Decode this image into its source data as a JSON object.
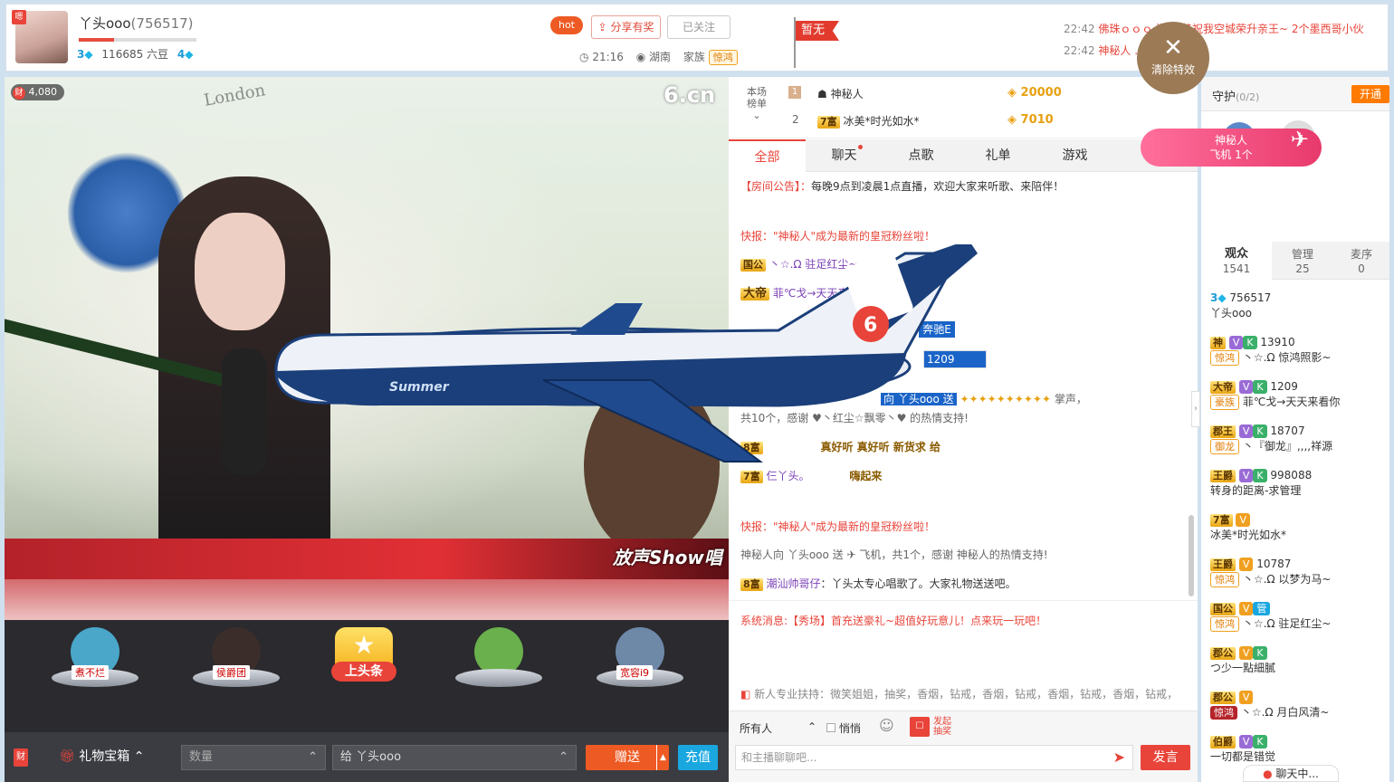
{
  "anchor": {
    "name": "丫头ooo",
    "id": "(756517)",
    "level_left": "3",
    "beans": "116685 六豆",
    "level_right": "4",
    "time": "21:16",
    "location": "湖南",
    "family_label": "家族",
    "family_badge": "惊鸿"
  },
  "header_buttons": {
    "hot": "hot",
    "share": "分享有奖",
    "followed": "已关注"
  },
  "flag": {
    "label": "暂无"
  },
  "ticker": [
    {
      "time": "22:42",
      "text": "佛珠ｏｏｏ 送给 恭祝我空城荣升亲王~ 2个墨西哥小伙"
    },
    {
      "time": "22:42",
      "text": "神秘人 ... 儿 1个别墅"
    }
  ],
  "clear_effects": "清除特效",
  "stage": {
    "wealth_badge": "财",
    "wealth_count": "4,080",
    "logo": "6.cn",
    "corner_logo": "放声Show唱"
  },
  "gifts": [
    {
      "label": "煮不烂",
      "theme": "#4aa7c9"
    },
    {
      "label": "侯爵团",
      "theme": "#3b2e2a"
    },
    {
      "label": "上头条",
      "theme": "#f2c230"
    },
    {
      "label": "",
      "theme": "#6ab04c"
    },
    {
      "label": "宽容i9",
      "theme": "#6e88a8"
    }
  ],
  "bottom": {
    "wealth_icon": "财",
    "treasure": "礼物宝箱",
    "qty_placeholder": "数量",
    "to_prefix": "给",
    "to_name": "丫头ooo",
    "send": "赠送",
    "recharge": "充值"
  },
  "rank": {
    "title_line1": "本场",
    "title_line2": "榜单",
    "rows": [
      {
        "rank": "1",
        "name": "神秘人",
        "amount": "20000"
      },
      {
        "rank": "2",
        "badge": "7富",
        "name": "冰美*时光如水*",
        "amount": "7010"
      }
    ]
  },
  "chat_tabs": [
    "全部",
    "聊天",
    "点歌",
    "礼单",
    "游戏"
  ],
  "chat": {
    "announce_label": "【房间公告】：",
    "announce_text": "每晚9点到凌晨1点直播，欢迎大家来听歌、来陪伴！",
    "flash1": "快报：\"神秘人\"成为最新的皇冠粉丝啦！",
    "l1_badge": "国公",
    "l1_name": "丶☆.Ω 驻足红尘~",
    "l2_badge": "大帝",
    "l2_name": "菲℃戈→天天来看你",
    "l3_tail": "奔驰E",
    "l4_num": "1209",
    "l5_mid": "向 丫头ooo 送",
    "l5_tail": "掌声，",
    "l6": "共10个，感谢 ♥丶红尘☆飘零丶♥ 的热情支持!",
    "l7_badge": "8富",
    "l7_words": "真好听 真好听 新货求 给",
    "l8_badge": "7富",
    "l8_name": "仨丫头。",
    "l8_words": "嗨起来",
    "flash2": "快报：\"神秘人\"成为最新的皇冠粉丝啦！",
    "l9": "神秘人向 丫头ooo 送 ✈ 飞机，共1个，感谢 神秘人的热情支持!",
    "l10_badge": "8富",
    "l10_name": "潮汕帅哥仔",
    "l10_text": "：丫头太专心唱歌了。大家礼物送送吧。",
    "system": "系统消息:【秀场】首充送豪礼~超值好玩意儿！点来玩一玩吧！",
    "marquee": "新人专业扶持：微笑姐姐，抽奖，香烟，钻戒，香烟，钻戒，香烟，钻戒，香烟，钻戒，"
  },
  "chat_footer": {
    "audience": "所有人",
    "whisper": "悄悄",
    "lottery_line1": "发起",
    "lottery_line2": "抽奖",
    "placeholder": "和主播聊聊吧...",
    "send": "发言"
  },
  "guard": {
    "title": "守护",
    "count": "(0/2)",
    "open": "开通"
  },
  "promo": {
    "line1": "神秘人",
    "line2": "飞机 1个"
  },
  "user_tabs": [
    {
      "label": "观众",
      "count": "1541"
    },
    {
      "label": "管理",
      "count": "25"
    },
    {
      "label": "麦序",
      "count": "0"
    }
  ],
  "users": [
    {
      "badge": "3",
      "id": "756517",
      "name": "丫头ooo",
      "family": ""
    },
    {
      "badge": "神",
      "id": "13910",
      "name": "丶☆.Ω 惊鸿照影~",
      "family": "惊鸿"
    },
    {
      "badge": "大帝",
      "id": "1209",
      "name": "菲℃戈→天天来看你",
      "family": "豪族"
    },
    {
      "badge": "郡王",
      "id": "18707",
      "name": "丶『御龙』,,,,祥源",
      "family": "御龙"
    },
    {
      "badge": "王爵",
      "id": "998088",
      "name": "转身的距离-求管理",
      "family": ""
    },
    {
      "badge": "7富",
      "id": "",
      "name": "冰美*时光如水*",
      "family": ""
    },
    {
      "badge": "王爵",
      "id": "10787",
      "name": "丶☆.Ω 以梦为马~",
      "family": "惊鸿"
    },
    {
      "badge": "国公",
      "id": "",
      "name": "丶☆.Ω 驻足红尘~",
      "family": "惊鸿"
    },
    {
      "badge": "郡公",
      "id": "",
      "name": "つ少一點細膩",
      "family": ""
    },
    {
      "badge": "郡公",
      "id": "",
      "name": "丶☆.Ω 月白风清~",
      "family": "惊鸿"
    },
    {
      "badge": "伯爵",
      "id": "",
      "name": "一切都是错觉",
      "family": ""
    }
  ],
  "chat_window": "聊天中..."
}
